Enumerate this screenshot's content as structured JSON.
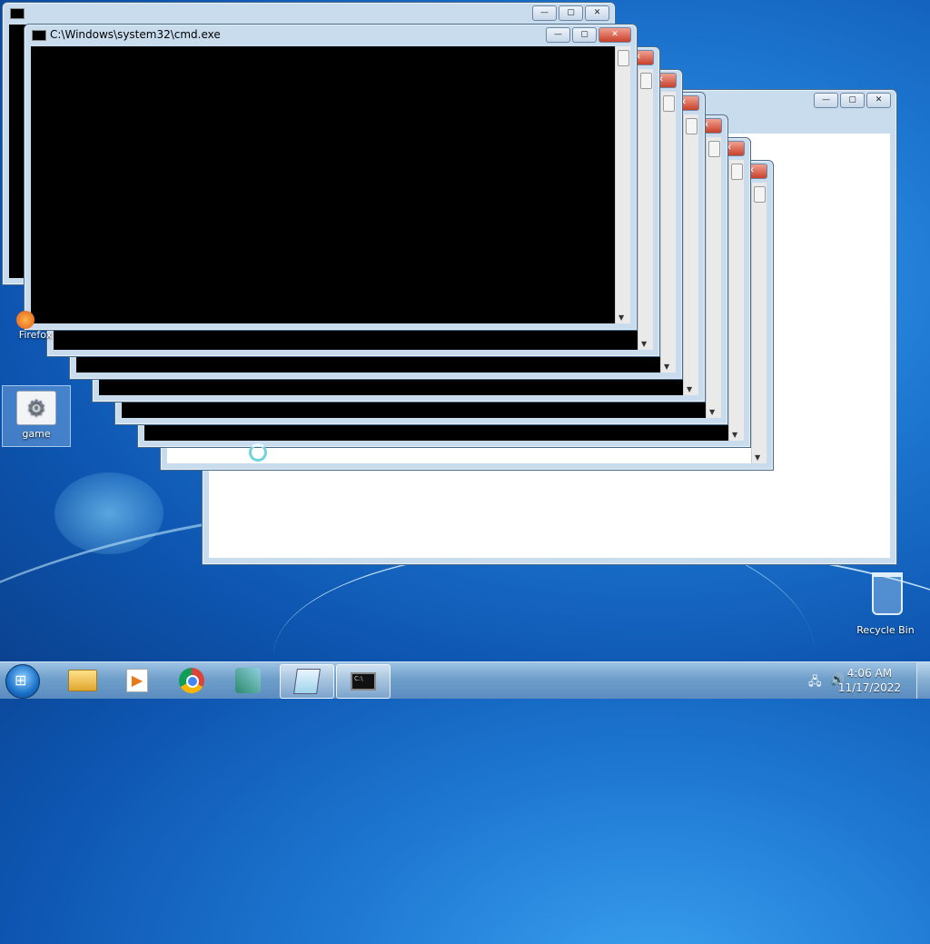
{
  "desktop": {
    "icons": [
      {
        "label": "Firefox"
      },
      {
        "label": "game"
      },
      {
        "label": "Recycle Bin"
      }
    ]
  },
  "windows": {
    "front_title": "C:\\Windows\\system32\\cmd.exe",
    "controls": {
      "minimize": "—",
      "maximize": "▢",
      "close": "✕"
    }
  },
  "taskbar": {
    "start_icon": "windows-orb-icon",
    "pinned": [
      {
        "name": "file-explorer-icon"
      },
      {
        "name": "media-player-icon"
      },
      {
        "name": "chrome-icon"
      },
      {
        "name": "app-installer-icon"
      },
      {
        "name": "notepad-icon"
      },
      {
        "name": "cmd-icon"
      }
    ],
    "clock": {
      "time": "4:06 AM",
      "date": "11/17/2022"
    }
  },
  "colors": {
    "accent": "#1e78d2",
    "close": "#c8402a"
  }
}
